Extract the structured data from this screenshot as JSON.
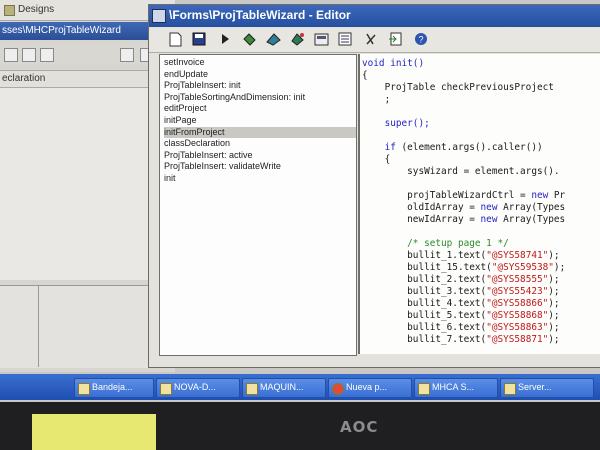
{
  "background_window": {
    "title": "Designs",
    "tab_label": "sses\\MHCProjTableWizard",
    "declaration_label": "eclaration"
  },
  "editor": {
    "title": "\\Forms\\ProjTableWizard - Editor",
    "toolbar": [
      "new-icon",
      "save-icon",
      "run-icon",
      "compile-icon",
      "lookup-icon",
      "breakpoint-icon",
      "properties-icon",
      "list-icon",
      "refresh-icon",
      "import-icon",
      "help-icon"
    ],
    "methods": [
      "setInvoice",
      "endUpdate",
      "ProjTableInsert: init",
      "ProjTableSortingAndDimension: init",
      "editProject",
      "initPage",
      "initFromProject",
      "classDeclaration",
      "ProjTableInsert: active",
      "ProjTableInsert: validateWrite",
      "init"
    ],
    "selected_method": "initFromProject",
    "code": {
      "l1": "void init()",
      "l2": "{",
      "l3": "    ProjTable checkPreviousProject",
      "l4": "    ;",
      "l5": "",
      "l6": "    super();",
      "l7": "",
      "l8a": "    if",
      "l8b": " (element.args().caller())",
      "l9": "    {",
      "l10": "        sysWizard = element.args().",
      "l11": "",
      "l12a": "        projTableWizardCtrl = ",
      "l12b": "new",
      "l12c": " Pr",
      "l13a": "        oldIdArray = ",
      "l13b": "new",
      "l13c": " Array(Types",
      "l14a": "        newIdArray = ",
      "l14b": "new",
      "l14c": " Array(Types",
      "l15": "",
      "l16": "        /* setup page 1 */",
      "bullits": [
        {
          "pre": "        bullit_1.text(",
          "str": "\"@SYS58741\"",
          "post": ");"
        },
        {
          "pre": "        bullit_15.text(",
          "str": "\"@SYS59538\"",
          "post": ");"
        },
        {
          "pre": "        bullit_2.text(",
          "str": "\"@SYS58555\"",
          "post": ");"
        },
        {
          "pre": "        bullit_3.text(",
          "str": "\"@SYS55423\"",
          "post": ");"
        },
        {
          "pre": "        bullit_4.text(",
          "str": "\"@SYS58866\"",
          "post": ");"
        },
        {
          "pre": "        bullit_5.text(",
          "str": "\"@SYS58868\"",
          "post": ");"
        },
        {
          "pre": "        bullit_6.text(",
          "str": "\"@SYS58863\"",
          "post": ");"
        },
        {
          "pre": "        bullit_7.text(",
          "str": "\"@SYS58871\"",
          "post": ");"
        }
      ]
    }
  },
  "taskbar": {
    "items": [
      "Bandeja...",
      "NOVA-D...",
      "MAQUIN...",
      "Nueva p...",
      "MHCA S...",
      "Server..."
    ]
  },
  "monitor": {
    "brand": "AOC"
  }
}
